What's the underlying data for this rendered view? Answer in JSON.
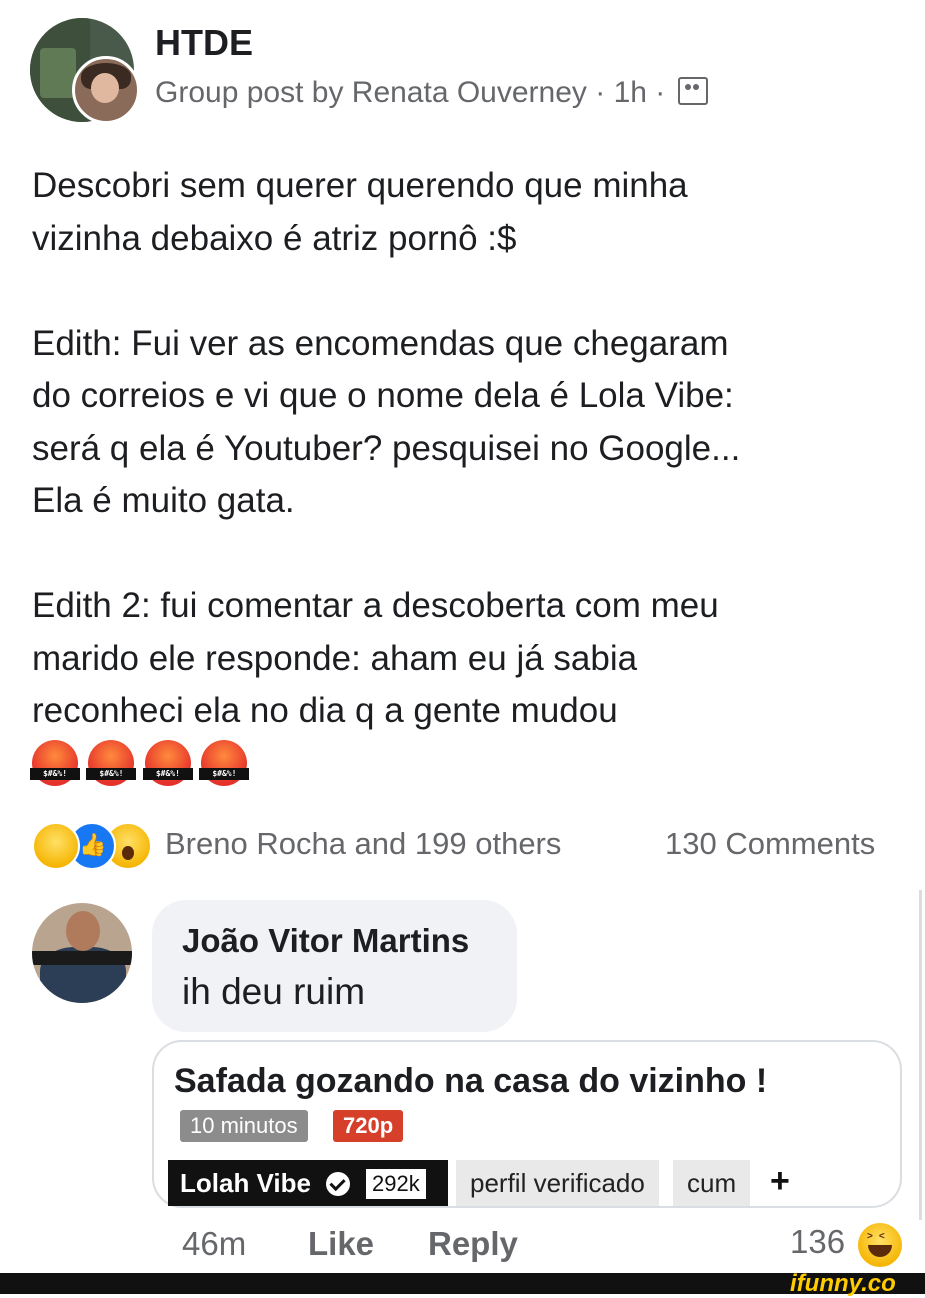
{
  "post": {
    "group_name": "HTDE",
    "meta": "Group post by Renata Ouverney · 1h ·",
    "privacy_icon": "group-members-icon",
    "text": "Descobri sem querer querendo que minha\nvizinha debaixo é atriz pornô :$\n\nEdith: Fui ver as encomendas que chegaram\ndo correios e vi que o nome dela é Lola Vibe:\nserá q ela é Youtuber? pesquisei no Google...\nEla é muito gata.\n\nEdith 2: fui comentar a descoberta com meu\nmarido ele responde: aham eu já sabia\nreconheci ela no dia q a gente mudou",
    "emoji_caption": "$#&%!",
    "emoji_count": 4
  },
  "reactions": {
    "icons": [
      "haha-icon",
      "like-icon",
      "wow-icon"
    ],
    "summary": "Breno Rocha and 199 others",
    "comments": "130 Comments"
  },
  "comment": {
    "author": "João Vitor Martins",
    "text": "ih deu ruim",
    "card": {
      "title": "Safada gozando na casa do vizinho !",
      "duration": "10 minutos",
      "quality": "720p",
      "channel": "Lolah Vibe",
      "subscribers": "292k",
      "tags": [
        "perfil verificado",
        "cum"
      ],
      "plus": "+"
    },
    "time": "46m",
    "like_label": "Like",
    "reply_label": "Reply",
    "reaction_count": "136"
  },
  "watermark": "ifunny.co",
  "colors": {
    "text": "#1c1e21",
    "secondary": "#65676b",
    "bubble": "#f0f2f5",
    "like_blue": "#1877f2",
    "quality_red": "#d6402b"
  }
}
